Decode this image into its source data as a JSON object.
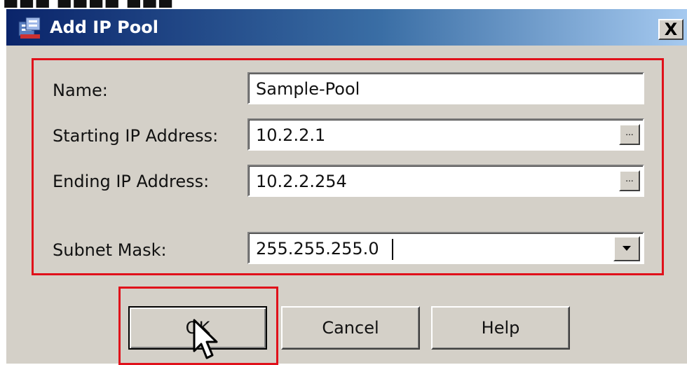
{
  "window": {
    "title": "Add IP Pool",
    "close_label": "X"
  },
  "form": {
    "name_label": "Name:",
    "name_value": "Sample-Pool",
    "start_label": "Starting IP Address:",
    "start_value": "10.2.2.1",
    "end_label": "Ending IP Address:",
    "end_value": "10.2.2.254",
    "mask_label": "Subnet Mask:",
    "mask_value": "255.255.255.0",
    "browse_label": "..."
  },
  "buttons": {
    "ok": "OK",
    "cancel": "Cancel",
    "help": "Help"
  },
  "colors": {
    "highlight": "#e0101a",
    "titlebar_start": "#0a246a",
    "titlebar_end": "#a6caf0",
    "dialog_bg": "#d4d0c8"
  },
  "icons": [
    "pool-icon",
    "close-icon",
    "ellipsis-icon",
    "chevron-down-icon",
    "mouse-pointer-icon"
  ]
}
